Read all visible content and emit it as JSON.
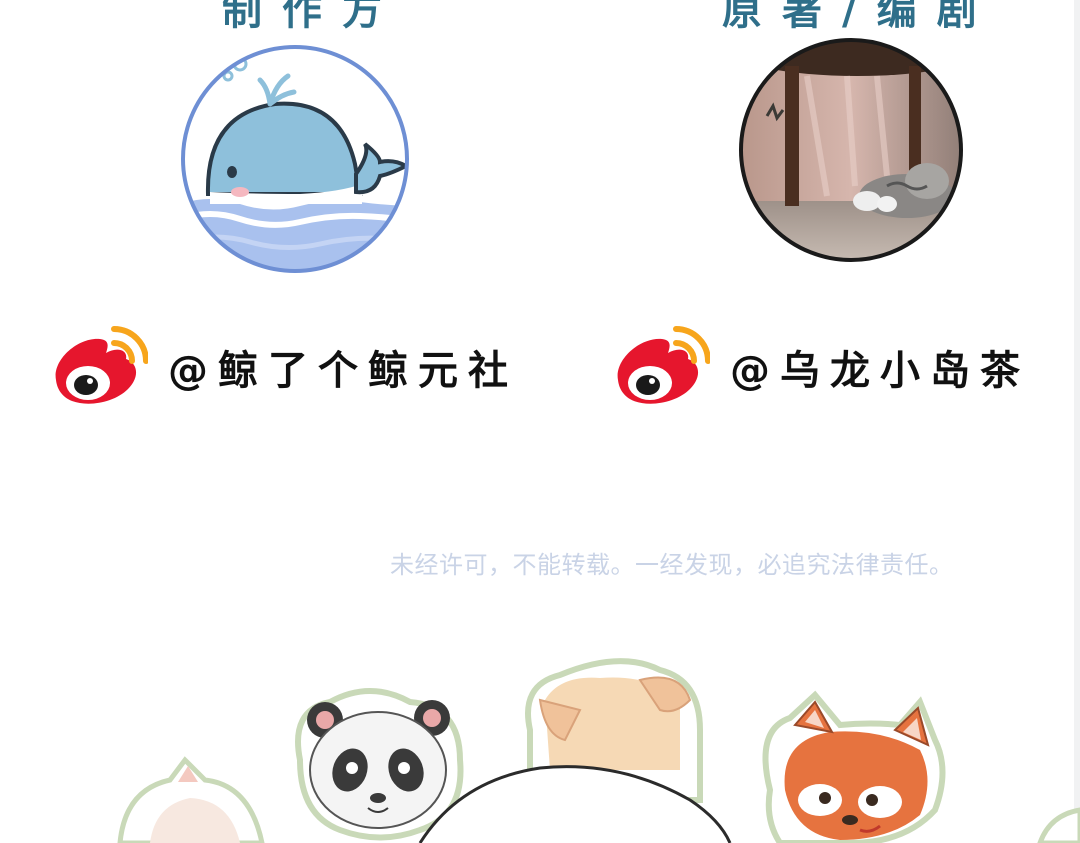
{
  "header": {
    "left_title": "制作方",
    "right_title": "原著/编剧"
  },
  "credits": {
    "producer": {
      "platform_icon": "weibo-icon",
      "handle": "@鲸了个鲸元社",
      "avatar": "whale-avatar"
    },
    "author": {
      "platform_icon": "weibo-icon",
      "handle": "@乌龙小岛茶",
      "avatar": "cat-photo-avatar"
    }
  },
  "notice": "未经许可，不能转载。一经发现，必追究法律责任。",
  "stickers": [
    "cat-sticker",
    "panda-sticker",
    "dog-sticker",
    "red-panda-sticker"
  ],
  "colors": {
    "header": "#2f6f8a",
    "notice": "#c9d3e6",
    "weibo_red": "#e6162d",
    "weibo_orange": "#f7a51c"
  }
}
